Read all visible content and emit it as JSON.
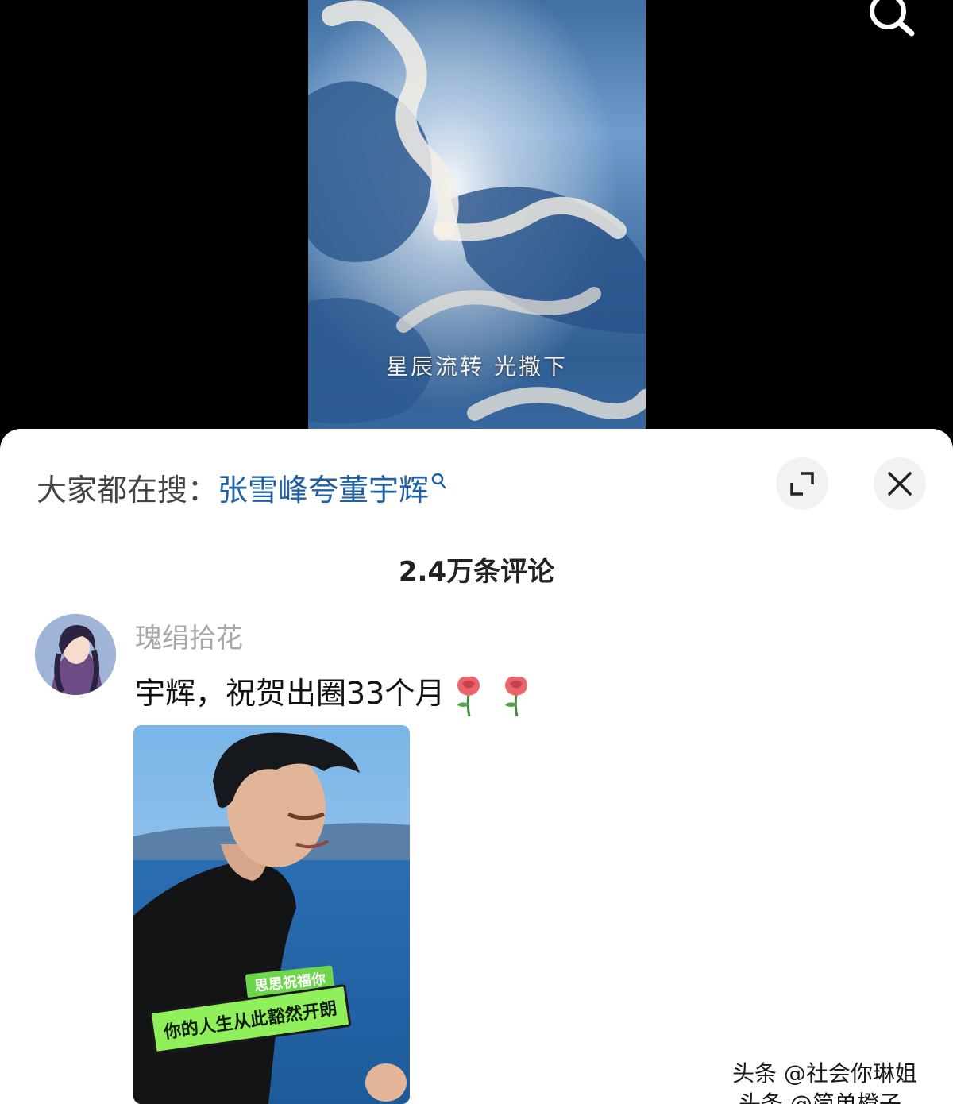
{
  "video": {
    "caption": "星辰流转 光撒下"
  },
  "icons": {
    "top_search": "search-icon",
    "expand": "expand-icon",
    "close": "close-icon",
    "hot_search": "search-icon"
  },
  "sheet": {
    "hot_search_prefix": "大家都在搜：",
    "hot_search_term": "张雪峰夸董宇辉",
    "comment_count": "2.4万条评论"
  },
  "comment": {
    "username": "瑰绢拾花",
    "text": "宇辉，祝贺出圈33个月",
    "emoji": [
      "🌹",
      "🌹"
    ],
    "image": {
      "sticker_top": "思思祝福你",
      "sticker_main": "你的人生从此豁然开朗"
    }
  },
  "watermark": {
    "line1": "头条 @社会你琳姐",
    "line2": "头条 @简单橙子"
  },
  "colors": {
    "link": "#1f5fa4",
    "username": "#a8a8a8",
    "sticker": "#8ff05c"
  }
}
